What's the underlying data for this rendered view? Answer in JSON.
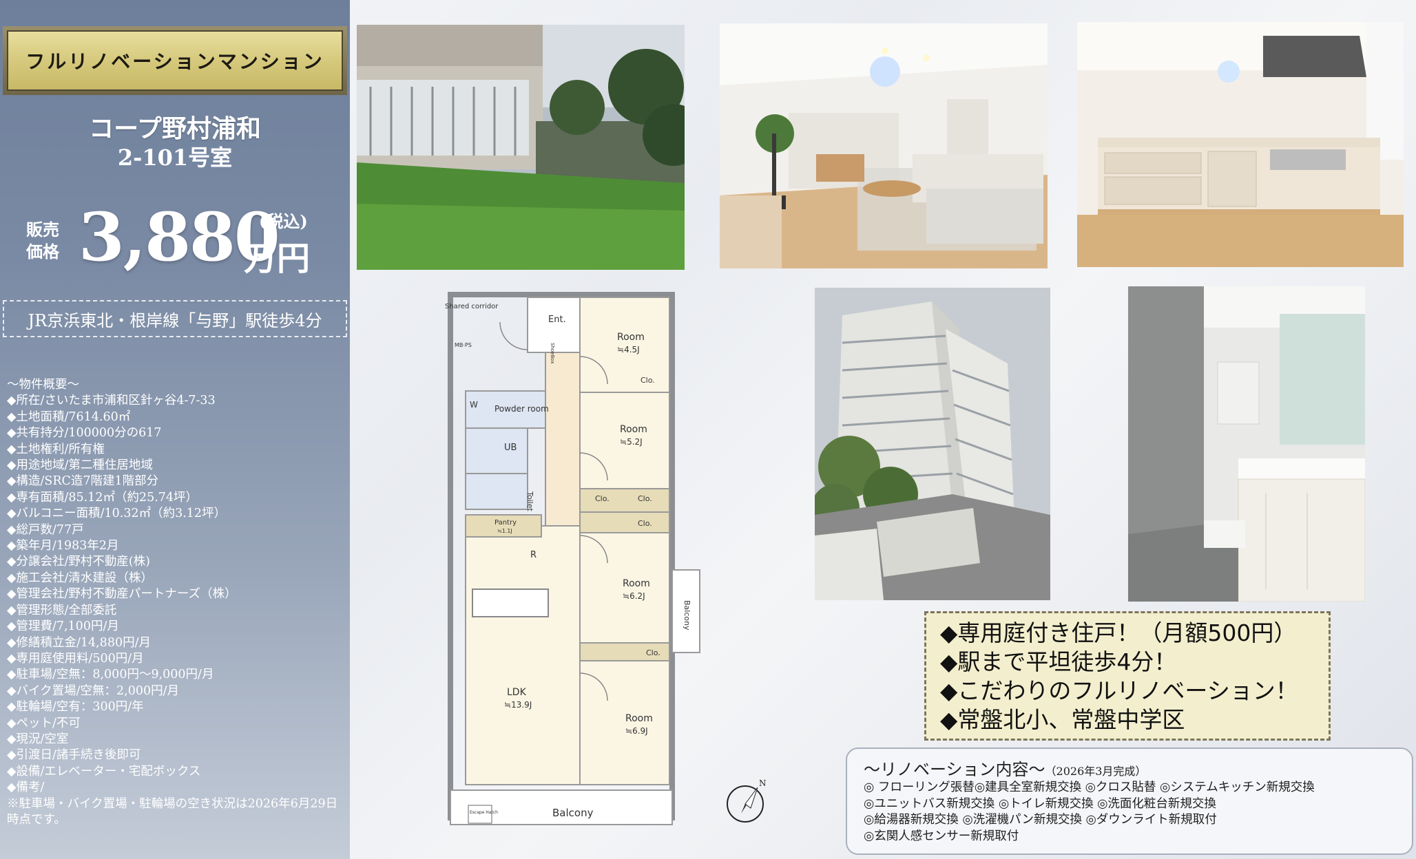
{
  "header": {
    "tag": "フルリノベーションマンション",
    "property_name": "コープ野村浦和",
    "room": "2-101号室"
  },
  "price": {
    "label_1": "販売",
    "label_2": "価格",
    "value": "3,880",
    "unit": "万円",
    "tax": "(税込)"
  },
  "station": "JR京浜東北・根岸線「与野」駅徒歩4分",
  "overview": {
    "title": "～物件概要～",
    "items": [
      "◆所在/さいたま市浦和区針ヶ谷4-7-33",
      "◆土地面積/7614.60㎡",
      "◆共有持分/100000分の617",
      "◆土地権利/所有権",
      "◆用途地域/第二種住居地域",
      "◆構造/SRC造7階建1階部分",
      "◆専有面積/85.12㎡（約25.74坪）",
      "◆バルコニー面積/10.32㎡（約3.12坪）",
      "◆総戸数/77戸",
      "◆築年月/1983年2月",
      "◆分譲会社/野村不動産(株)",
      "◆施工会社/清水建設（株）",
      "◆管理会社/野村不動産パートナーズ（株）",
      "◆管理形態/全部委託",
      "◆管理費/7,100円/月",
      "◆修繕積立金/14,880円/月",
      "◆専用庭使用料/500円/月",
      "◆駐車場/空無：8,000円～9,000円/月",
      "◆バイク置場/空無：2,000円/月",
      "◆駐輪場/空有：300円/年",
      "◆ペット/不可",
      "◆現況/空室",
      "◆引渡日/諸手続き後即可",
      "◆設備/エレベーター・宅配ボックス",
      "◆備考/"
    ],
    "note": "※駐車場・バイク置場・駐輪場の空き状況は2026年6月29日時点です。"
  },
  "floorplan": {
    "shared_corridor": "Shared corridor",
    "mbps": "MB·PS",
    "ent": "Ent.",
    "shoe_box": "ShoeBox",
    "w": "W",
    "powder_room": "Powder room",
    "ub": "UB",
    "toilet": "Toilet",
    "pantry": "Pantry",
    "pantry_size": "≒1.1J",
    "r": "R",
    "ldk": "LDK",
    "ldk_size": "≒13.9J",
    "room1": "Room",
    "room1_size": "≒4.5J",
    "room2": "Room",
    "room2_size": "≒5.2J",
    "room3": "Room",
    "room3_size": "≒6.2J",
    "room4": "Room",
    "room4_size": "≒6.9J",
    "clo": "Clo.",
    "balcony_bottom": "Balcony",
    "balcony_side": "Balcony",
    "escape_hatch": "Escape Hatch",
    "compass_n": "N"
  },
  "features": [
    "◆専用庭付き住戸！（月額500円）",
    "◆駅まで平坦徒歩4分！",
    "◆こだわりのフルリノベーション！",
    "◆常盤北小、常盤中学区"
  ],
  "renovation": {
    "title": "～リノベーション内容～",
    "subtitle": "（2026年3月完成）",
    "lines": [
      "◎ フローリング張替◎建具全室新規交換 ◎クロス貼替 ◎システムキッチン新規交換",
      "◎ユニットバス新規交換 ◎トイレ新規交換 ◎洗面化粧台新規交換",
      "◎給湯器新規交換 ◎洗濯機パン新規交換 ◎ダウンライト新規取付",
      "◎玄関人感センサー新規取付"
    ]
  }
}
